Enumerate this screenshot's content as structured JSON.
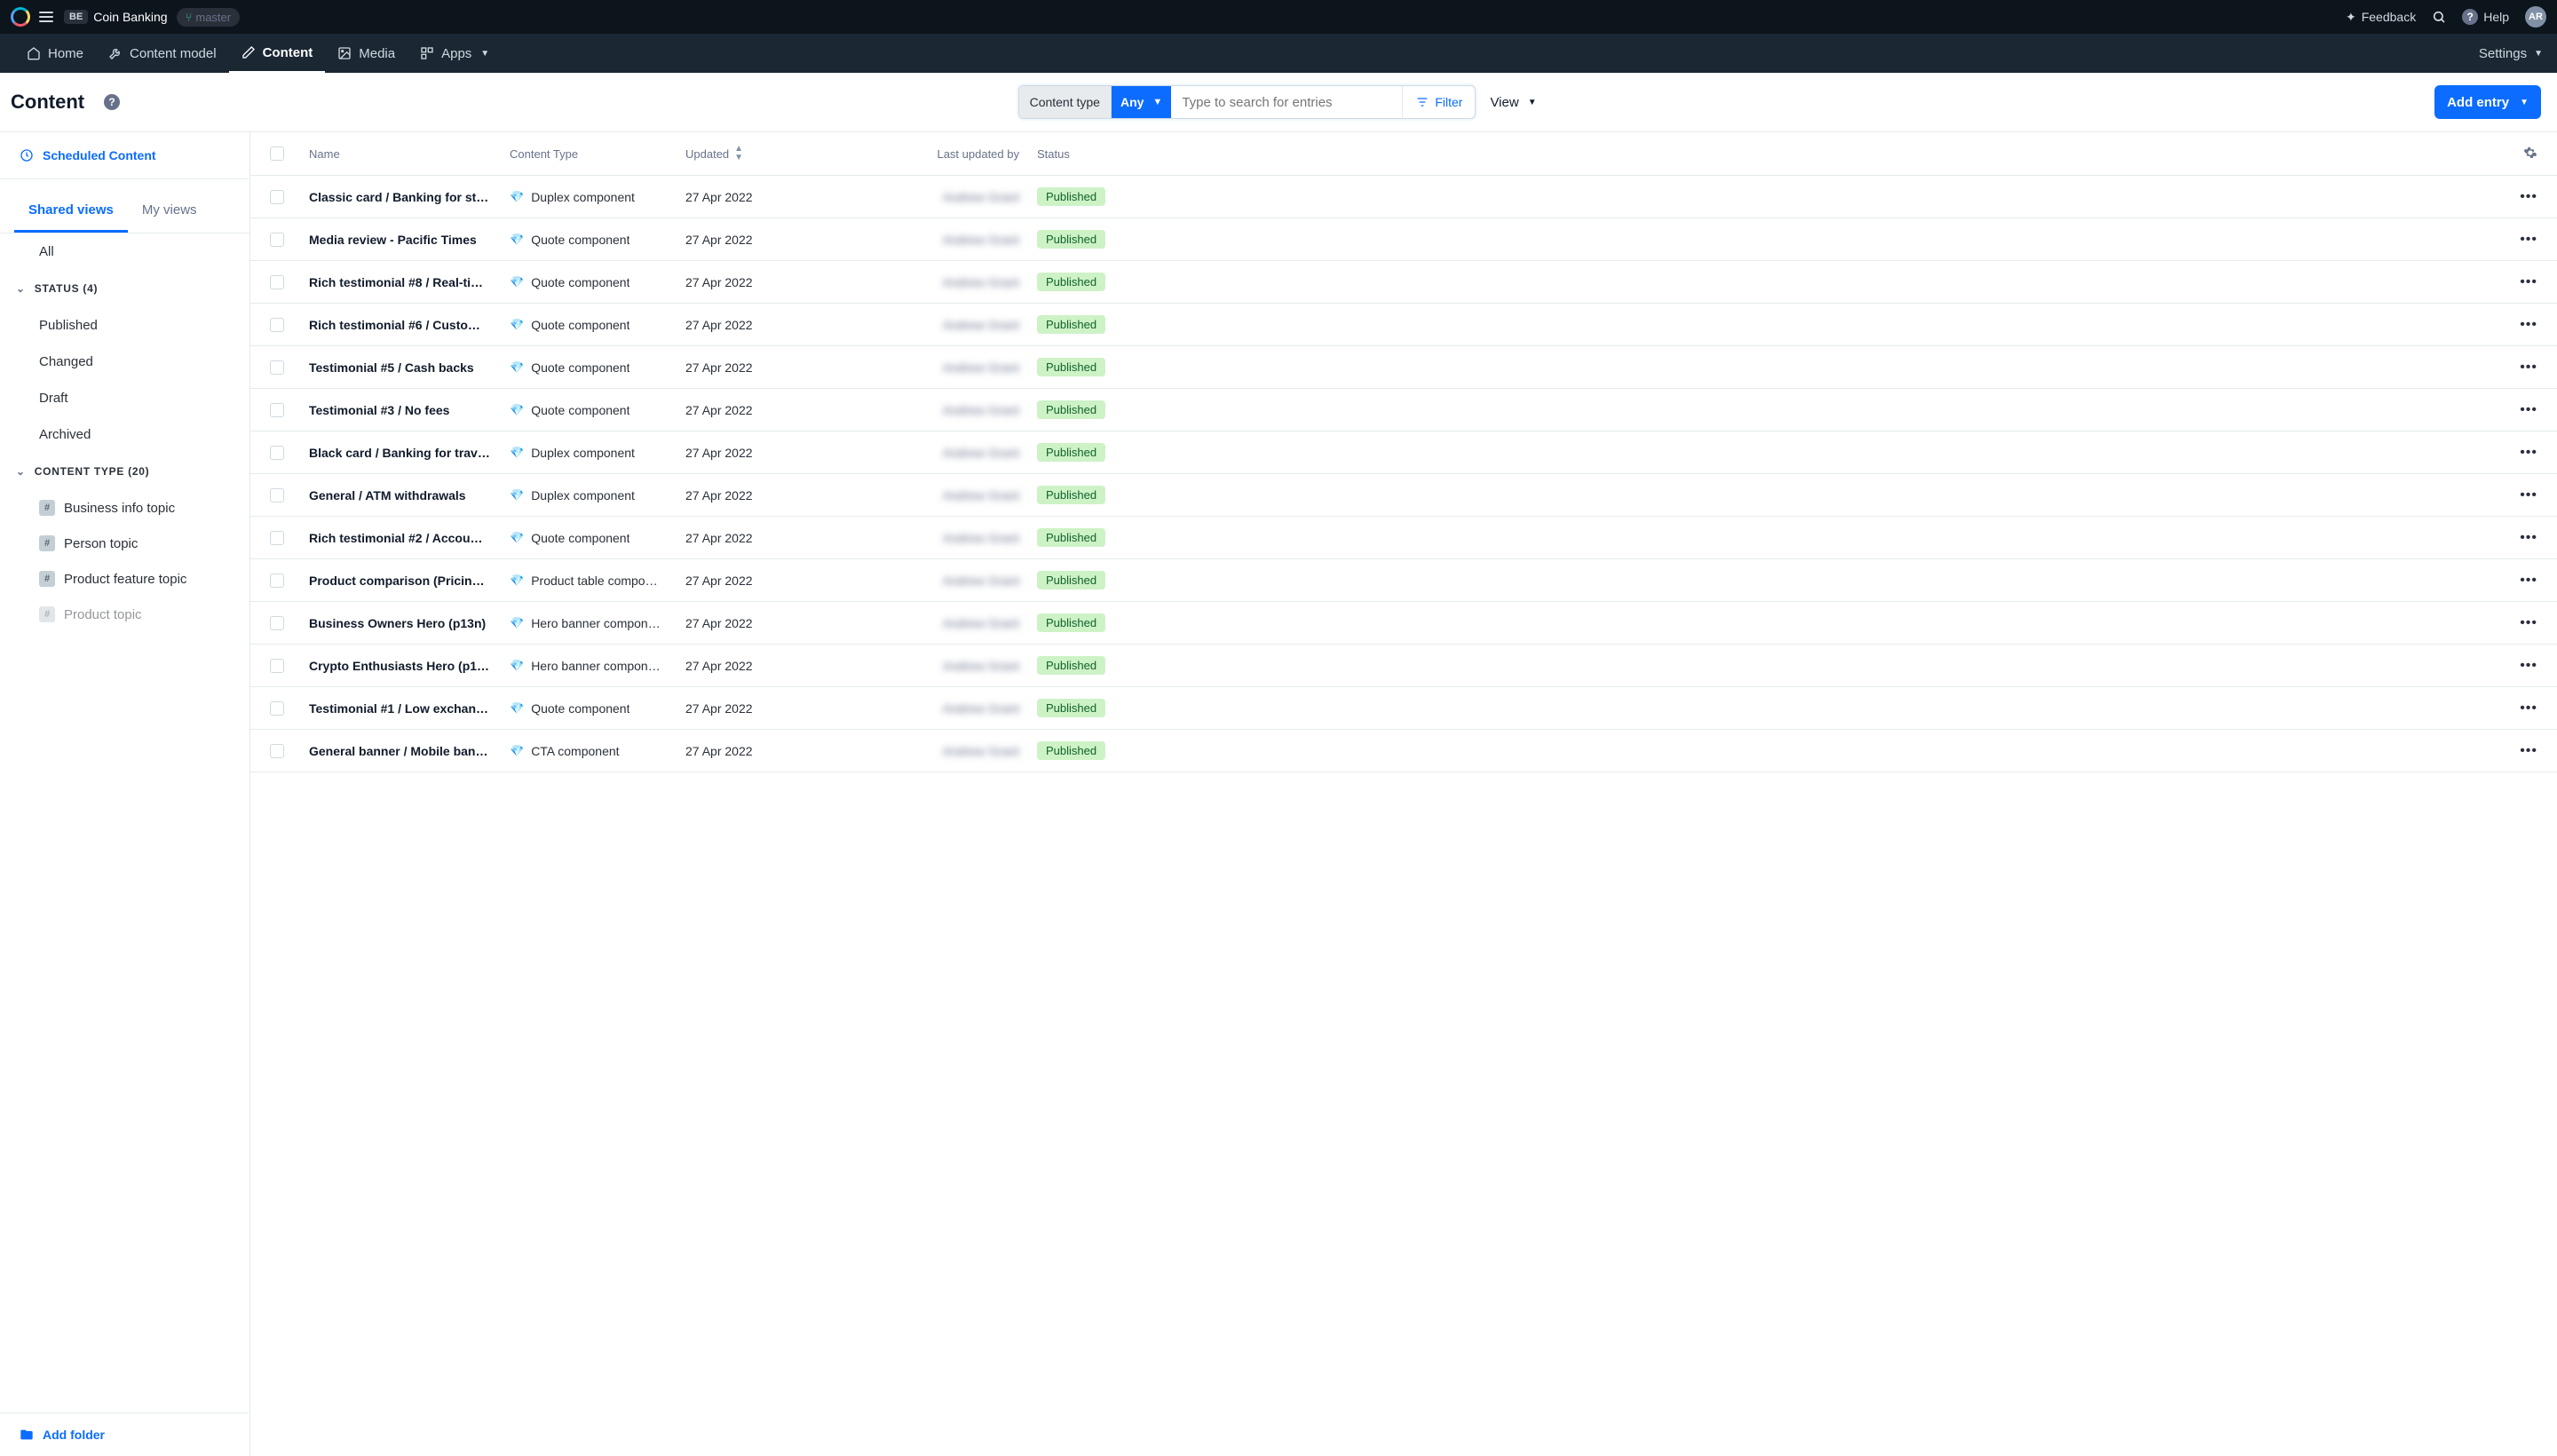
{
  "topbar": {
    "org_badge": "BE",
    "space_name": "Coin Banking",
    "branch": "master",
    "feedback_label": "Feedback",
    "help_label": "Help",
    "avatar_initials": "AR"
  },
  "nav": {
    "home": "Home",
    "content_model": "Content model",
    "content": "Content",
    "media": "Media",
    "apps": "Apps",
    "settings": "Settings"
  },
  "header": {
    "page_title": "Content",
    "content_type_label": "Content type",
    "content_type_value": "Any",
    "search_placeholder": "Type to search for entries",
    "filter_label": "Filter",
    "view_label": "View",
    "add_entry_label": "Add entry"
  },
  "sidebar": {
    "scheduled_label": "Scheduled Content",
    "tabs": {
      "shared": "Shared views",
      "my": "My views"
    },
    "all_label": "All",
    "status_header": "STATUS (4)",
    "status_items": [
      "Published",
      "Changed",
      "Draft",
      "Archived"
    ],
    "ct_header": "CONTENT TYPE (20)",
    "ct_items": [
      "Business info topic",
      "Person topic",
      "Product feature topic",
      "Product topic"
    ],
    "add_folder_label": "Add folder"
  },
  "table": {
    "columns": {
      "name": "Name",
      "ct": "Content Type",
      "updated": "Updated",
      "by": "Last updated by",
      "status": "Status"
    },
    "rows": [
      {
        "name": "Classic card / Banking for st…",
        "ct": "Duplex component",
        "updated": "27 Apr 2022",
        "by": "Andrew Grant",
        "status": "Published"
      },
      {
        "name": "Media review - Pacific Times",
        "ct": "Quote component",
        "updated": "27 Apr 2022",
        "by": "Andrew Grant",
        "status": "Published"
      },
      {
        "name": "Rich testimonial #8 / Real-ti…",
        "ct": "Quote component",
        "updated": "27 Apr 2022",
        "by": "Andrew Grant",
        "status": "Published"
      },
      {
        "name": "Rich testimonial #6 / Custo…",
        "ct": "Quote component",
        "updated": "27 Apr 2022",
        "by": "Andrew Grant",
        "status": "Published"
      },
      {
        "name": "Testimonial #5 / Cash backs",
        "ct": "Quote component",
        "updated": "27 Apr 2022",
        "by": "Andrew Grant",
        "status": "Published"
      },
      {
        "name": "Testimonial #3 / No fees",
        "ct": "Quote component",
        "updated": "27 Apr 2022",
        "by": "Andrew Grant",
        "status": "Published"
      },
      {
        "name": "Black card / Banking for trav…",
        "ct": "Duplex component",
        "updated": "27 Apr 2022",
        "by": "Andrew Grant",
        "status": "Published"
      },
      {
        "name": "General / ATM withdrawals",
        "ct": "Duplex component",
        "updated": "27 Apr 2022",
        "by": "Andrew Grant",
        "status": "Published"
      },
      {
        "name": "Rich testimonial #2 / Accou…",
        "ct": "Quote component",
        "updated": "27 Apr 2022",
        "by": "Andrew Grant",
        "status": "Published"
      },
      {
        "name": "Product comparison (Pricin…",
        "ct": "Product table compo…",
        "updated": "27 Apr 2022",
        "by": "Andrew Grant",
        "status": "Published"
      },
      {
        "name": "Business Owners Hero (p13n)",
        "ct": "Hero banner compon…",
        "updated": "27 Apr 2022",
        "by": "Andrew Grant",
        "status": "Published"
      },
      {
        "name": "Crypto Enthusiasts Hero (p1…",
        "ct": "Hero banner compon…",
        "updated": "27 Apr 2022",
        "by": "Andrew Grant",
        "status": "Published"
      },
      {
        "name": "Testimonial #1 / Low exchan…",
        "ct": "Quote component",
        "updated": "27 Apr 2022",
        "by": "Andrew Grant",
        "status": "Published"
      },
      {
        "name": "General banner / Mobile ban…",
        "ct": "CTA component",
        "updated": "27 Apr 2022",
        "by": "Andrew Grant",
        "status": "Published"
      }
    ]
  }
}
